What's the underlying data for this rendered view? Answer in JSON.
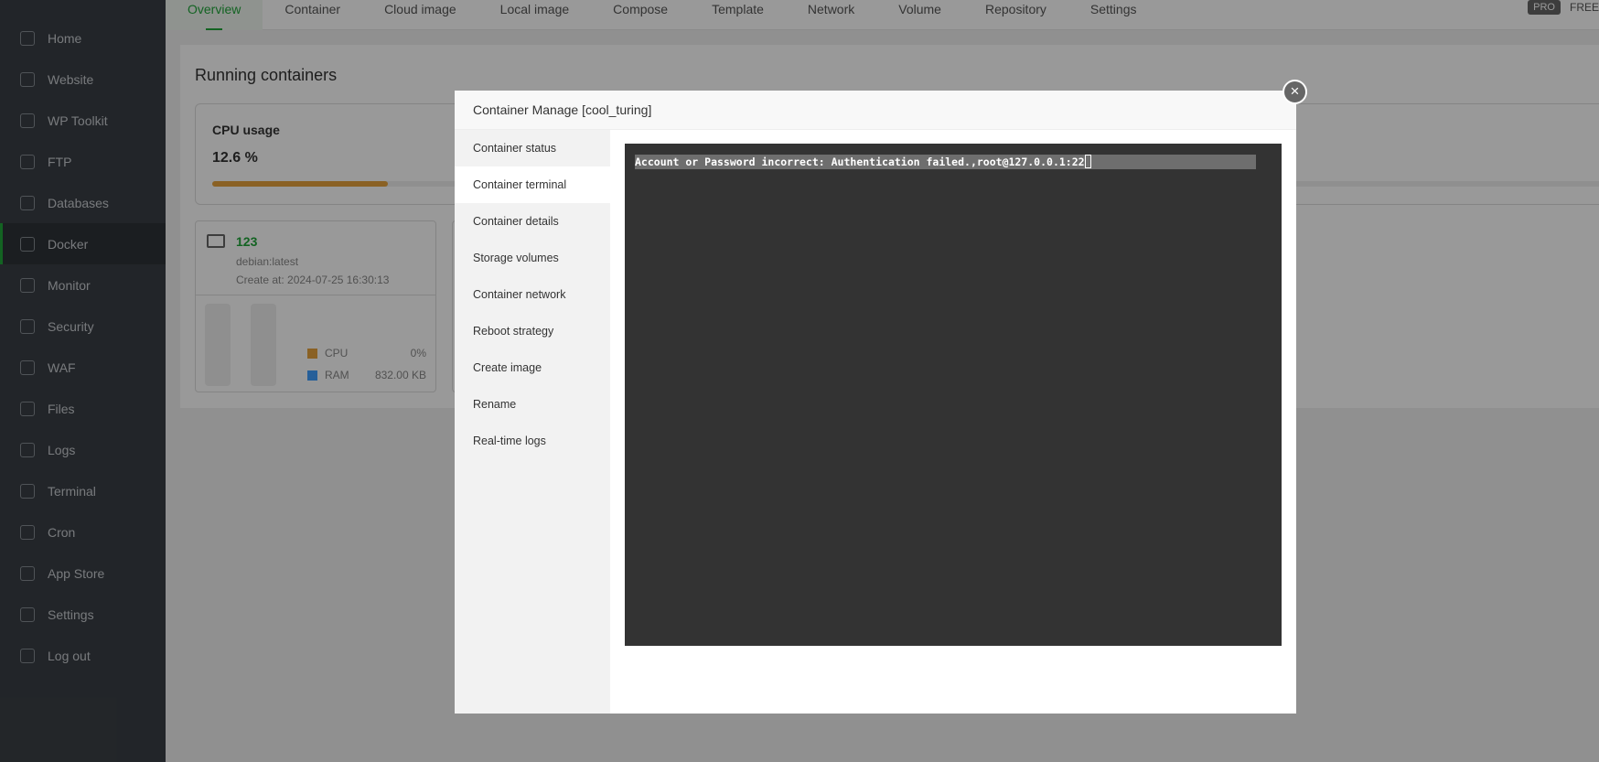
{
  "sidebar": {
    "items": [
      {
        "label": "Home"
      },
      {
        "label": "Website"
      },
      {
        "label": "WP Toolkit"
      },
      {
        "label": "FTP"
      },
      {
        "label": "Databases"
      },
      {
        "label": "Docker"
      },
      {
        "label": "Monitor"
      },
      {
        "label": "Security"
      },
      {
        "label": "WAF"
      },
      {
        "label": "Files"
      },
      {
        "label": "Logs"
      },
      {
        "label": "Terminal"
      },
      {
        "label": "Cron"
      },
      {
        "label": "App Store"
      },
      {
        "label": "Settings"
      },
      {
        "label": "Log out"
      }
    ]
  },
  "tabs": [
    {
      "label": "Overview"
    },
    {
      "label": "Container"
    },
    {
      "label": "Cloud image"
    },
    {
      "label": "Local image"
    },
    {
      "label": "Compose"
    },
    {
      "label": "Template"
    },
    {
      "label": "Network"
    },
    {
      "label": "Volume"
    },
    {
      "label": "Repository"
    },
    {
      "label": "Settings"
    }
  ],
  "header": {
    "pro": "PRO",
    "free": "FREE"
  },
  "main": {
    "title": "Running containers",
    "cpu": {
      "label": "CPU usage",
      "value": "12.6 %",
      "percent": 12.6
    },
    "container": {
      "name": "123",
      "image": "debian:latest",
      "created": "Create at: 2024-07-25 16:30:13",
      "cpu_label": "CPU",
      "cpu_value": "0%",
      "ram_label": "RAM",
      "ram_value": "832.00 KB"
    }
  },
  "modal": {
    "title": "Container Manage [cool_turing]",
    "close": "×",
    "menu": [
      {
        "label": "Container status"
      },
      {
        "label": "Container terminal"
      },
      {
        "label": "Container details"
      },
      {
        "label": "Storage volumes"
      },
      {
        "label": "Container network"
      },
      {
        "label": "Reboot strategy"
      },
      {
        "label": "Create image"
      },
      {
        "label": "Rename"
      },
      {
        "label": "Real-time logs"
      }
    ],
    "terminal": {
      "output": "Account or Password incorrect: Authentication failed.,root@127.0.0.1:22"
    }
  },
  "colors": {
    "accent": "#20a53a",
    "cpu": "#e6a23c",
    "ram": "#409eff"
  }
}
